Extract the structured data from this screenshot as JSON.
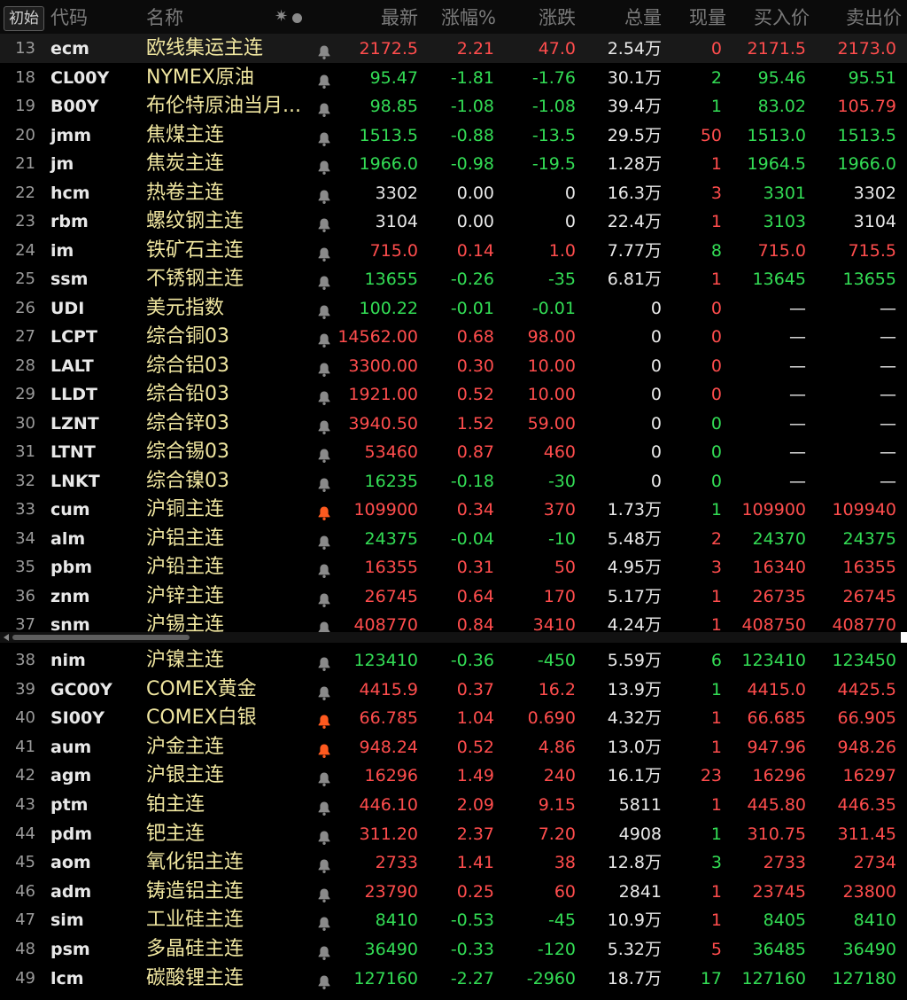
{
  "header": {
    "init_button": "初始",
    "col_code": "代码",
    "col_name": "名称",
    "col_latest": "最新",
    "col_change_pct": "涨幅%",
    "col_change": "涨跌",
    "col_volume": "总量",
    "col_current_volume": "现量",
    "col_bid": "买入价",
    "col_ask": "卖出价"
  },
  "colors": {
    "up": "#ff4d4d",
    "down": "#33dd55",
    "flat": "#e8e8e8",
    "name": "#f0e6a0",
    "bell_active": "#ff5a1f",
    "bell_inactive": "#8a8a8a"
  },
  "rows": [
    {
      "idx": "13",
      "code": "ecm",
      "name": "欧线集运主连",
      "bell": "inactive",
      "latest": "2172.5",
      "pct": "2.21",
      "chg": "47.0",
      "vol": "2.54万",
      "now": "0",
      "bid": "2171.5",
      "ask": "2173.0",
      "latest_c": "red",
      "pct_c": "red",
      "chg_c": "red",
      "now_c": "red",
      "bid_c": "red",
      "ask_c": "red"
    },
    {
      "idx": "18",
      "code": "CL00Y",
      "name": "NYMEX原油",
      "bell": "inactive",
      "latest": "95.47",
      "pct": "-1.81",
      "chg": "-1.76",
      "vol": "30.1万",
      "now": "2",
      "bid": "95.46",
      "ask": "95.51",
      "latest_c": "green",
      "pct_c": "green",
      "chg_c": "green",
      "now_c": "green",
      "bid_c": "green",
      "ask_c": "green"
    },
    {
      "idx": "19",
      "code": "B00Y",
      "name": "布伦特原油当月...",
      "bell": "inactive",
      "latest": "98.85",
      "pct": "-1.08",
      "chg": "-1.08",
      "vol": "39.4万",
      "now": "1",
      "bid": "83.02",
      "ask": "105.79",
      "latest_c": "green",
      "pct_c": "green",
      "chg_c": "green",
      "now_c": "green",
      "bid_c": "green",
      "ask_c": "red"
    },
    {
      "idx": "20",
      "code": "jmm",
      "name": "焦煤主连",
      "bell": "inactive",
      "latest": "1513.5",
      "pct": "-0.88",
      "chg": "-13.5",
      "vol": "29.5万",
      "now": "50",
      "bid": "1513.0",
      "ask": "1513.5",
      "latest_c": "green",
      "pct_c": "green",
      "chg_c": "green",
      "now_c": "red",
      "bid_c": "green",
      "ask_c": "green"
    },
    {
      "idx": "21",
      "code": "jm",
      "name": "焦炭主连",
      "bell": "inactive",
      "latest": "1966.0",
      "pct": "-0.98",
      "chg": "-19.5",
      "vol": "1.28万",
      "now": "1",
      "bid": "1964.5",
      "ask": "1966.0",
      "latest_c": "green",
      "pct_c": "green",
      "chg_c": "green",
      "now_c": "red",
      "bid_c": "green",
      "ask_c": "green"
    },
    {
      "idx": "22",
      "code": "hcm",
      "name": "热卷主连",
      "bell": "inactive",
      "latest": "3302",
      "pct": "0.00",
      "chg": "0",
      "vol": "16.3万",
      "now": "3",
      "bid": "3301",
      "ask": "3302",
      "latest_c": "white",
      "pct_c": "white",
      "chg_c": "white",
      "now_c": "red",
      "bid_c": "green",
      "ask_c": "white"
    },
    {
      "idx": "23",
      "code": "rbm",
      "name": "螺纹钢主连",
      "bell": "inactive",
      "latest": "3104",
      "pct": "0.00",
      "chg": "0",
      "vol": "22.4万",
      "now": "1",
      "bid": "3103",
      "ask": "3104",
      "latest_c": "white",
      "pct_c": "white",
      "chg_c": "white",
      "now_c": "red",
      "bid_c": "green",
      "ask_c": "white"
    },
    {
      "idx": "24",
      "code": "im",
      "name": "铁矿石主连",
      "bell": "inactive",
      "latest": "715.0",
      "pct": "0.14",
      "chg": "1.0",
      "vol": "7.77万",
      "now": "8",
      "bid": "715.0",
      "ask": "715.5",
      "latest_c": "red",
      "pct_c": "red",
      "chg_c": "red",
      "now_c": "green",
      "bid_c": "red",
      "ask_c": "red"
    },
    {
      "idx": "25",
      "code": "ssm",
      "name": "不锈钢主连",
      "bell": "inactive",
      "latest": "13655",
      "pct": "-0.26",
      "chg": "-35",
      "vol": "6.81万",
      "now": "1",
      "bid": "13645",
      "ask": "13655",
      "latest_c": "green",
      "pct_c": "green",
      "chg_c": "green",
      "now_c": "red",
      "bid_c": "green",
      "ask_c": "green"
    },
    {
      "idx": "26",
      "code": "UDI",
      "name": "美元指数",
      "bell": "inactive",
      "latest": "100.22",
      "pct": "-0.01",
      "chg": "-0.01",
      "vol": "0",
      "now": "0",
      "bid": "—",
      "ask": "—",
      "latest_c": "green",
      "pct_c": "green",
      "chg_c": "green",
      "now_c": "red",
      "bid_c": "white",
      "ask_c": "white"
    },
    {
      "idx": "27",
      "code": "LCPT",
      "name": "综合铜03",
      "bell": "inactive",
      "latest": "14562.00",
      "pct": "0.68",
      "chg": "98.00",
      "vol": "0",
      "now": "0",
      "bid": "—",
      "ask": "—",
      "latest_c": "red",
      "pct_c": "red",
      "chg_c": "red",
      "now_c": "red",
      "bid_c": "white",
      "ask_c": "white"
    },
    {
      "idx": "28",
      "code": "LALT",
      "name": "综合铝03",
      "bell": "inactive",
      "latest": "3300.00",
      "pct": "0.30",
      "chg": "10.00",
      "vol": "0",
      "now": "0",
      "bid": "—",
      "ask": "—",
      "latest_c": "red",
      "pct_c": "red",
      "chg_c": "red",
      "now_c": "red",
      "bid_c": "white",
      "ask_c": "white"
    },
    {
      "idx": "29",
      "code": "LLDT",
      "name": "综合铅03",
      "bell": "inactive",
      "latest": "1921.00",
      "pct": "0.52",
      "chg": "10.00",
      "vol": "0",
      "now": "0",
      "bid": "—",
      "ask": "—",
      "latest_c": "red",
      "pct_c": "red",
      "chg_c": "red",
      "now_c": "red",
      "bid_c": "white",
      "ask_c": "white"
    },
    {
      "idx": "30",
      "code": "LZNT",
      "name": "综合锌03",
      "bell": "inactive",
      "latest": "3940.50",
      "pct": "1.52",
      "chg": "59.00",
      "vol": "0",
      "now": "0",
      "bid": "—",
      "ask": "—",
      "latest_c": "red",
      "pct_c": "red",
      "chg_c": "red",
      "now_c": "green",
      "bid_c": "white",
      "ask_c": "white"
    },
    {
      "idx": "31",
      "code": "LTNT",
      "name": "综合锡03",
      "bell": "inactive",
      "latest": "53460",
      "pct": "0.87",
      "chg": "460",
      "vol": "0",
      "now": "0",
      "bid": "—",
      "ask": "—",
      "latest_c": "red",
      "pct_c": "red",
      "chg_c": "red",
      "now_c": "green",
      "bid_c": "white",
      "ask_c": "white"
    },
    {
      "idx": "32",
      "code": "LNKT",
      "name": "综合镍03",
      "bell": "inactive",
      "latest": "16235",
      "pct": "-0.18",
      "chg": "-30",
      "vol": "0",
      "now": "0",
      "bid": "—",
      "ask": "—",
      "latest_c": "green",
      "pct_c": "green",
      "chg_c": "green",
      "now_c": "green",
      "bid_c": "white",
      "ask_c": "white"
    },
    {
      "idx": "33",
      "code": "cum",
      "name": "沪铜主连",
      "bell": "active",
      "latest": "109900",
      "pct": "0.34",
      "chg": "370",
      "vol": "1.73万",
      "now": "1",
      "bid": "109900",
      "ask": "109940",
      "latest_c": "red",
      "pct_c": "red",
      "chg_c": "red",
      "now_c": "green",
      "bid_c": "red",
      "ask_c": "red"
    },
    {
      "idx": "34",
      "code": "alm",
      "name": "沪铝主连",
      "bell": "inactive",
      "latest": "24375",
      "pct": "-0.04",
      "chg": "-10",
      "vol": "5.48万",
      "now": "2",
      "bid": "24370",
      "ask": "24375",
      "latest_c": "green",
      "pct_c": "green",
      "chg_c": "green",
      "now_c": "red",
      "bid_c": "green",
      "ask_c": "green"
    },
    {
      "idx": "35",
      "code": "pbm",
      "name": "沪铅主连",
      "bell": "inactive",
      "latest": "16355",
      "pct": "0.31",
      "chg": "50",
      "vol": "4.95万",
      "now": "3",
      "bid": "16340",
      "ask": "16355",
      "latest_c": "red",
      "pct_c": "red",
      "chg_c": "red",
      "now_c": "red",
      "bid_c": "red",
      "ask_c": "red"
    },
    {
      "idx": "36",
      "code": "znm",
      "name": "沪锌主连",
      "bell": "inactive",
      "latest": "26745",
      "pct": "0.64",
      "chg": "170",
      "vol": "5.17万",
      "now": "1",
      "bid": "26735",
      "ask": "26745",
      "latest_c": "red",
      "pct_c": "red",
      "chg_c": "red",
      "now_c": "red",
      "bid_c": "red",
      "ask_c": "red"
    },
    {
      "idx": "37",
      "code": "snm",
      "name": "沪锡主连",
      "bell": "inactive",
      "latest": "408770",
      "pct": "0.84",
      "chg": "3410",
      "vol": "4.24万",
      "now": "1",
      "bid": "408750",
      "ask": "408770",
      "latest_c": "red",
      "pct_c": "red",
      "chg_c": "red",
      "now_c": "red",
      "bid_c": "red",
      "ask_c": "red"
    },
    {
      "idx": "38",
      "code": "nim",
      "name": "沪镍主连",
      "bell": "inactive",
      "latest": "123410",
      "pct": "-0.36",
      "chg": "-450",
      "vol": "5.59万",
      "now": "6",
      "bid": "123410",
      "ask": "123450",
      "latest_c": "green",
      "pct_c": "green",
      "chg_c": "green",
      "now_c": "green",
      "bid_c": "green",
      "ask_c": "green"
    },
    {
      "idx": "39",
      "code": "GC00Y",
      "name": "COMEX黄金",
      "bell": "inactive",
      "latest": "4415.9",
      "pct": "0.37",
      "chg": "16.2",
      "vol": "13.9万",
      "now": "1",
      "bid": "4415.0",
      "ask": "4425.5",
      "latest_c": "red",
      "pct_c": "red",
      "chg_c": "red",
      "now_c": "green",
      "bid_c": "red",
      "ask_c": "red"
    },
    {
      "idx": "40",
      "code": "SI00Y",
      "name": "COMEX白银",
      "bell": "active",
      "latest": "66.785",
      "pct": "1.04",
      "chg": "0.690",
      "vol": "4.32万",
      "now": "1",
      "bid": "66.685",
      "ask": "66.905",
      "latest_c": "red",
      "pct_c": "red",
      "chg_c": "red",
      "now_c": "red",
      "bid_c": "red",
      "ask_c": "red"
    },
    {
      "idx": "41",
      "code": "aum",
      "name": "沪金主连",
      "bell": "active",
      "latest": "948.24",
      "pct": "0.52",
      "chg": "4.86",
      "vol": "13.0万",
      "now": "1",
      "bid": "947.96",
      "ask": "948.26",
      "latest_c": "red",
      "pct_c": "red",
      "chg_c": "red",
      "now_c": "red",
      "bid_c": "red",
      "ask_c": "red"
    },
    {
      "idx": "42",
      "code": "agm",
      "name": "沪银主连",
      "bell": "inactive",
      "latest": "16296",
      "pct": "1.49",
      "chg": "240",
      "vol": "16.1万",
      "now": "23",
      "bid": "16296",
      "ask": "16297",
      "latest_c": "red",
      "pct_c": "red",
      "chg_c": "red",
      "now_c": "red",
      "bid_c": "red",
      "ask_c": "red"
    },
    {
      "idx": "43",
      "code": "ptm",
      "name": "铂主连",
      "bell": "inactive",
      "latest": "446.10",
      "pct": "2.09",
      "chg": "9.15",
      "vol": "5811",
      "now": "1",
      "bid": "445.80",
      "ask": "446.35",
      "latest_c": "red",
      "pct_c": "red",
      "chg_c": "red",
      "now_c": "red",
      "bid_c": "red",
      "ask_c": "red"
    },
    {
      "idx": "44",
      "code": "pdm",
      "name": "钯主连",
      "bell": "inactive",
      "latest": "311.20",
      "pct": "2.37",
      "chg": "7.20",
      "vol": "4908",
      "now": "1",
      "bid": "310.75",
      "ask": "311.45",
      "latest_c": "red",
      "pct_c": "red",
      "chg_c": "red",
      "now_c": "green",
      "bid_c": "red",
      "ask_c": "red"
    },
    {
      "idx": "45",
      "code": "aom",
      "name": "氧化铝主连",
      "bell": "inactive",
      "latest": "2733",
      "pct": "1.41",
      "chg": "38",
      "vol": "12.8万",
      "now": "3",
      "bid": "2733",
      "ask": "2734",
      "latest_c": "red",
      "pct_c": "red",
      "chg_c": "red",
      "now_c": "green",
      "bid_c": "red",
      "ask_c": "red"
    },
    {
      "idx": "46",
      "code": "adm",
      "name": "铸造铝主连",
      "bell": "inactive",
      "latest": "23790",
      "pct": "0.25",
      "chg": "60",
      "vol": "2841",
      "now": "1",
      "bid": "23745",
      "ask": "23800",
      "latest_c": "red",
      "pct_c": "red",
      "chg_c": "red",
      "now_c": "red",
      "bid_c": "red",
      "ask_c": "red"
    },
    {
      "idx": "47",
      "code": "sim",
      "name": "工业硅主连",
      "bell": "inactive",
      "latest": "8410",
      "pct": "-0.53",
      "chg": "-45",
      "vol": "10.9万",
      "now": "1",
      "bid": "8405",
      "ask": "8410",
      "latest_c": "green",
      "pct_c": "green",
      "chg_c": "green",
      "now_c": "red",
      "bid_c": "green",
      "ask_c": "green"
    },
    {
      "idx": "48",
      "code": "psm",
      "name": "多晶硅主连",
      "bell": "inactive",
      "latest": "36490",
      "pct": "-0.33",
      "chg": "-120",
      "vol": "5.32万",
      "now": "5",
      "bid": "36485",
      "ask": "36490",
      "latest_c": "green",
      "pct_c": "green",
      "chg_c": "green",
      "now_c": "red",
      "bid_c": "green",
      "ask_c": "green"
    },
    {
      "idx": "49",
      "code": "lcm",
      "name": "碳酸锂主连",
      "bell": "inactive",
      "latest": "127160",
      "pct": "-2.27",
      "chg": "-2960",
      "vol": "18.7万",
      "now": "17",
      "bid": "127160",
      "ask": "127180",
      "latest_c": "green",
      "pct_c": "green",
      "chg_c": "green",
      "now_c": "green",
      "bid_c": "green",
      "ask_c": "green"
    }
  ]
}
